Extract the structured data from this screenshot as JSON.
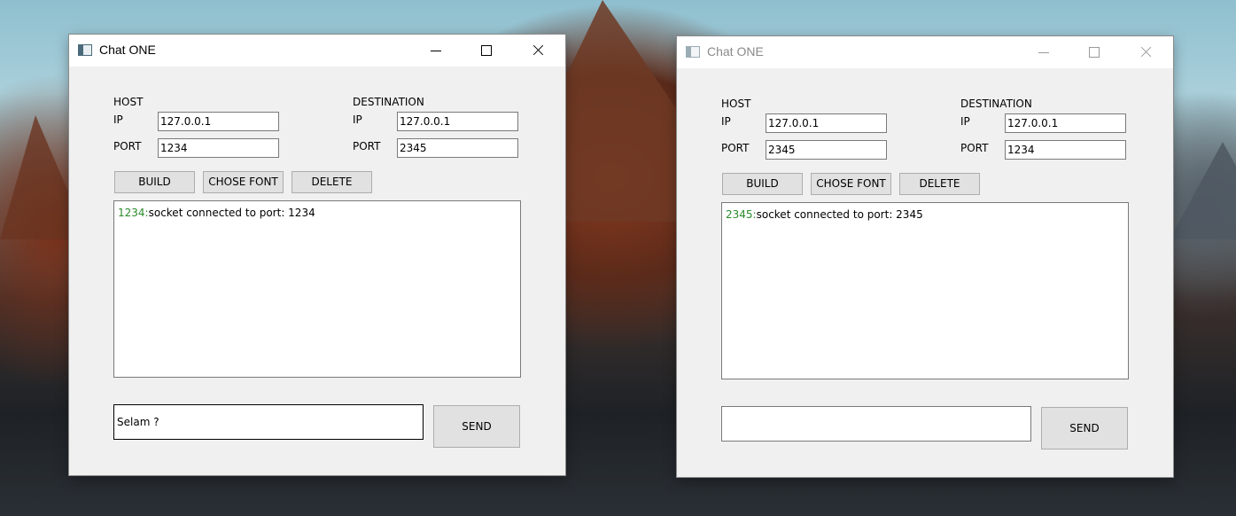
{
  "windows": [
    {
      "title": "Chat ONE",
      "host": {
        "heading": "HOST",
        "ip_label": "IP",
        "ip": "127.0.0.1",
        "port_label": "PORT",
        "port": "1234"
      },
      "destination": {
        "heading": "DESTINATION",
        "ip_label": "IP",
        "ip": "127.0.0.1",
        "port_label": "PORT",
        "port": "2345"
      },
      "buttons": {
        "build": "BUILD",
        "font": "CHOSE FONT",
        "delete": "DELETE",
        "send": "SEND"
      },
      "log": {
        "port": "1234:",
        "text": "socket connected to port: 1234"
      },
      "message": "Selam ?"
    },
    {
      "title": "Chat ONE",
      "host": {
        "heading": "HOST",
        "ip_label": "IP",
        "ip": "127.0.0.1",
        "port_label": "PORT",
        "port": "2345"
      },
      "destination": {
        "heading": "DESTINATION",
        "ip_label": "IP",
        "ip": "127.0.0.1",
        "port_label": "PORT",
        "port": "1234"
      },
      "buttons": {
        "build": "BUILD",
        "font": "CHOSE FONT",
        "delete": "DELETE",
        "send": "SEND"
      },
      "log": {
        "port": "2345:",
        "text": "socket connected to port: 2345"
      },
      "message": ""
    }
  ]
}
